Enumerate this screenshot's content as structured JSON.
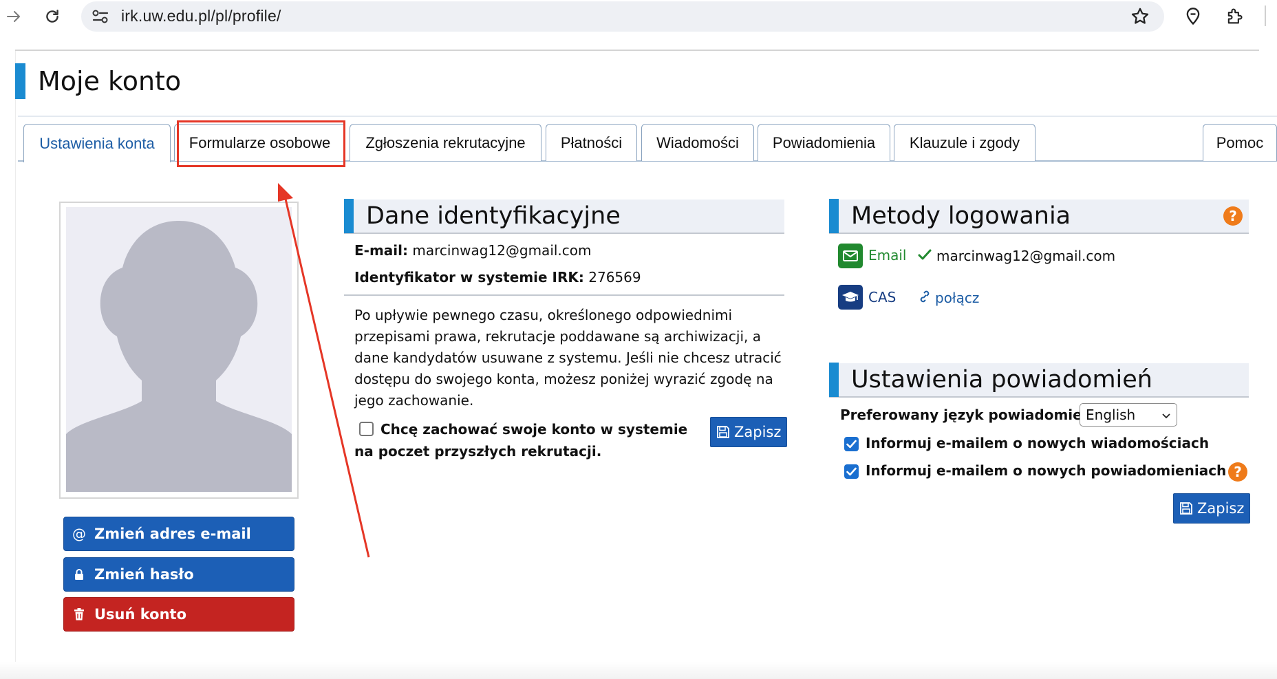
{
  "browser": {
    "url": "irk.uw.edu.pl/pl/profile/"
  },
  "page": {
    "title": "Moje konto"
  },
  "tabs": [
    {
      "label": "Ustawienia konta",
      "active": true
    },
    {
      "label": "Formularze osobowe",
      "active": false,
      "highlighted": true
    },
    {
      "label": "Zgłoszenia rekrutacyjne",
      "active": false
    },
    {
      "label": "Płatności",
      "active": false
    },
    {
      "label": "Wiadomości",
      "active": false
    },
    {
      "label": "Powiadomienia",
      "active": false
    },
    {
      "label": "Klauzule i zgody",
      "active": false
    },
    {
      "label": "Pomoc",
      "active": false
    }
  ],
  "sidebar": {
    "change_email": "Zmień adres e-mail",
    "change_password": "Zmień hasło",
    "delete_account": "Usuń konto"
  },
  "identity": {
    "heading": "Dane identyfikacyjne",
    "email_label": "E-mail:",
    "email_value": "marcinwag12@gmail.com",
    "id_label": "Identyfikator w systemie IRK:",
    "id_value": "276569",
    "archive_text": "Po upływie pewnego czasu, określonego odpowiednimi przepisami prawa, rekrutacje poddawane są archiwizacji, a dane kandydatów usuwane z systemu. Jeśli nie chcesz utracić dostępu do swojego konta, możesz poniżej wyrazić zgodę na jego zachowanie.",
    "keep_account_label": "Chcę zachować swoje konto w systemie na poczet przyszłych rekrutacji.",
    "keep_account_checked": false,
    "save_label": "Zapisz"
  },
  "login_methods": {
    "heading": "Metody logowania",
    "help": "?",
    "email_method": "Email",
    "email_value": "marcinwag12@gmail.com",
    "cas_method": "CAS",
    "cas_connect": "połącz"
  },
  "notifications": {
    "heading": "Ustawienia powiadomień",
    "language_label": "Preferowany język powiadomień:",
    "language_value": "English",
    "notify_messages": "Informuj e-mailem o nowych wiadomościach",
    "notify_messages_checked": true,
    "notify_notifications": "Informuj e-mailem o nowych powiadomieniach",
    "notify_notifications_checked": true,
    "help": "?",
    "save_label": "Zapisz"
  },
  "colors": {
    "accent": "#1a8bd1",
    "button_blue": "#1c5fb6",
    "button_red": "#c42421",
    "help_orange": "#ef7b1a",
    "annotation_red": "#e53626",
    "email_green": "#21892f"
  }
}
